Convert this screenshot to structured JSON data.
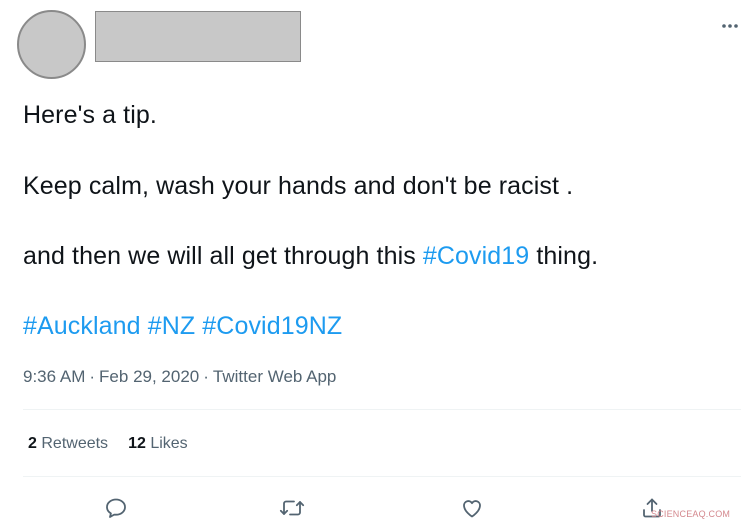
{
  "tweet": {
    "paragraphs": {
      "p1": "Here's a tip.",
      "p2": "Keep calm, wash your hands and don't be racist .",
      "p3_before": "and then we will all get through this ",
      "p3_hashtag": "#Covid19",
      "p3_after": " thing.",
      "p4_hashtags": [
        "#Auckland",
        "#NZ",
        "#Covid19NZ"
      ]
    },
    "time": "9:36 AM",
    "date": "Feb 29, 2020",
    "separator": "·",
    "source": "Twitter Web App",
    "retweets_count": "2",
    "retweets_label": "Retweets",
    "likes_count": "12",
    "likes_label": "Likes"
  },
  "icons": {
    "more": "more-horizontal-icon",
    "reply": "reply-icon",
    "retweet": "retweet-icon",
    "like": "heart-icon",
    "share": "share-icon"
  },
  "watermark": "SCIENCEAQ.COM",
  "colors": {
    "link": "#1d9bf0",
    "text": "#0f1419",
    "secondary": "#536471",
    "redaction": "#c8c8c8"
  }
}
